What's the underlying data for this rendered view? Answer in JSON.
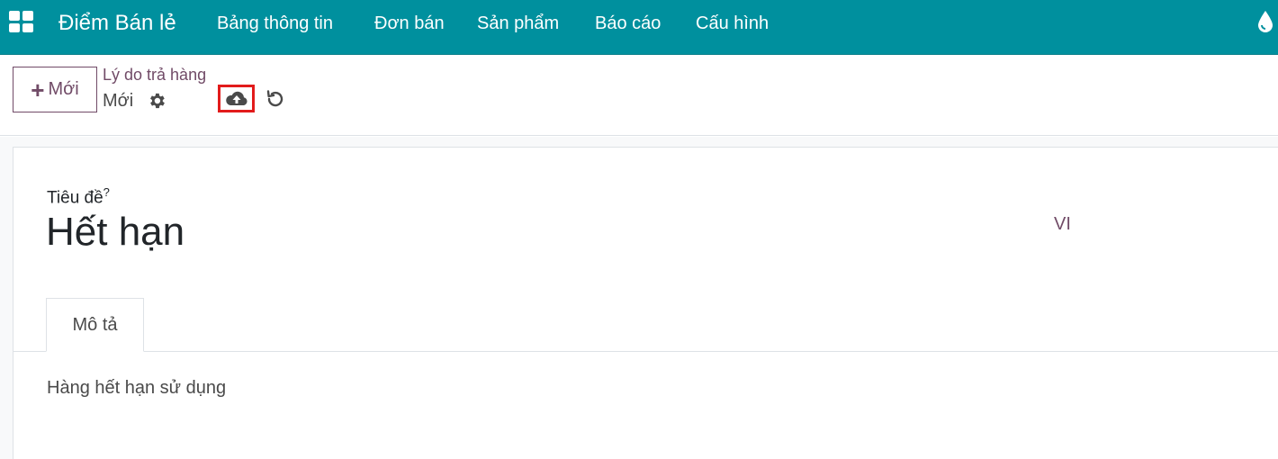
{
  "navbar": {
    "brand": "Điểm Bán lẻ",
    "menu": [
      {
        "label": "Bảng thông tin"
      },
      {
        "label": "Đơn bán"
      },
      {
        "label": "Sản phẩm"
      },
      {
        "label": "Báo cáo"
      },
      {
        "label": "Cấu hình"
      }
    ],
    "bg_color": "#00909e"
  },
  "control_panel": {
    "new_button_label": "Mới",
    "breadcrumb": "Lý do trả hàng",
    "record_name": "Mới"
  },
  "form": {
    "title_label": "Tiêu đề",
    "title_help": "?",
    "title_value": "Hết hạn",
    "lang_label": "VI",
    "tabs": [
      {
        "label": "Mô tả"
      }
    ],
    "description": "Hàng hết hạn sử dụng"
  },
  "colors": {
    "accent": "#714b67",
    "highlight_box": "#e21b1b"
  }
}
